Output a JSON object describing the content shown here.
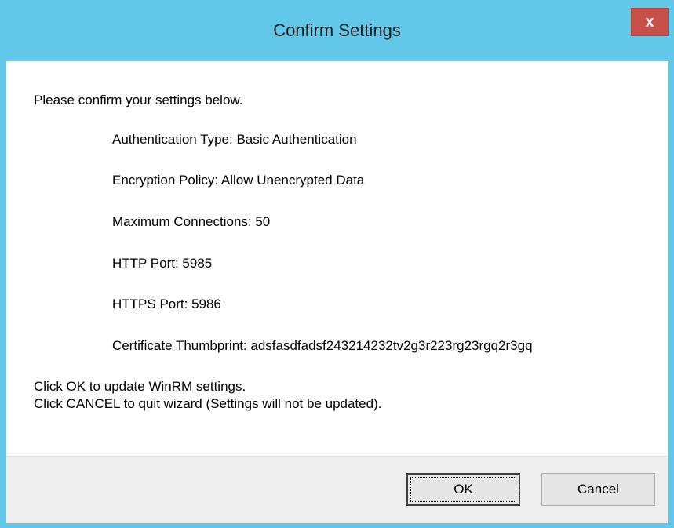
{
  "window": {
    "title": "Confirm Settings",
    "close_label": "x"
  },
  "content": {
    "intro": "Please confirm your settings below.",
    "settings": [
      "Authentication Type: Basic Authentication",
      "Encryption Policy: Allow Unencrypted Data",
      "Maximum Connections: 50",
      "HTTP Port: 5985",
      "HTTPS Port: 5986",
      "Certificate Thumbprint: adsfasdfadsf243214232tv2g3r223rg23rgq2r3gq"
    ],
    "footer": [
      "Click OK to update WinRM settings.",
      "Click CANCEL to quit wizard (Settings will not be updated)."
    ]
  },
  "buttons": {
    "ok": "OK",
    "cancel": "Cancel"
  },
  "colors": {
    "titlebar": "#62c8ea",
    "close_button": "#c7514a"
  }
}
